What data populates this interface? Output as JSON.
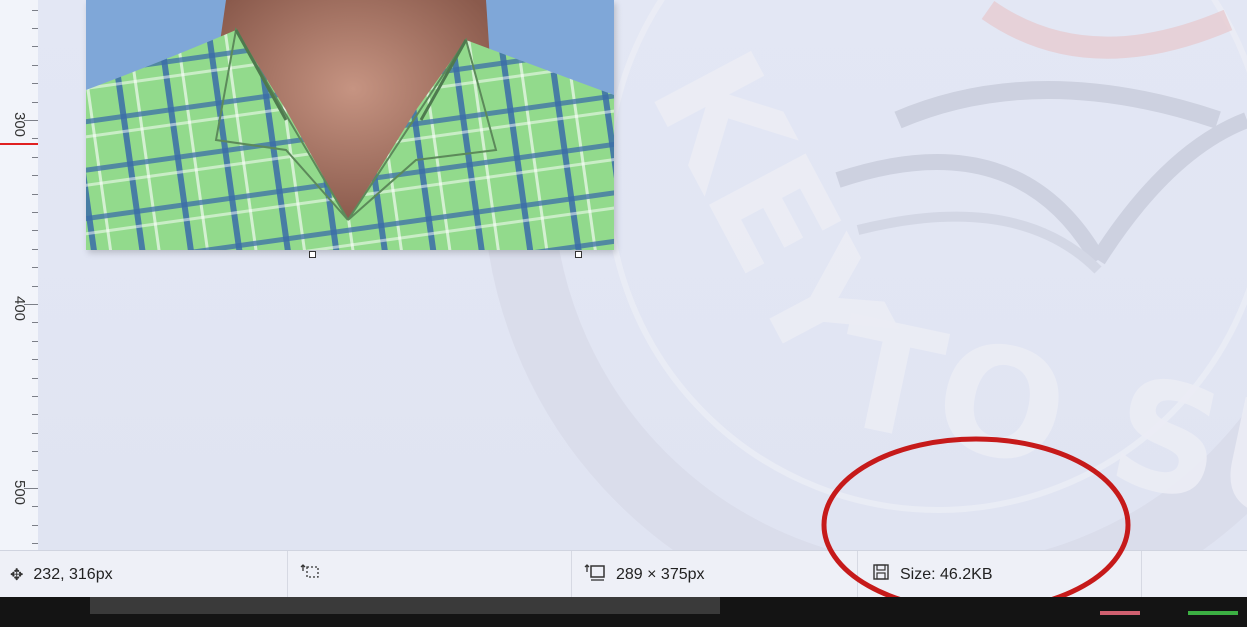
{
  "ruler": {
    "labels": [
      "300",
      "400",
      "500"
    ]
  },
  "statusbar": {
    "cursor_position": "232, 316px",
    "selection_size": "",
    "image_size": "289 × 375px",
    "file_size": "Size: 46.2KB",
    "icons": {
      "cursor": "move-crosshair-icon",
      "selection": "selection-icon",
      "image": "image-size-icon",
      "file": "save-disk-icon"
    }
  },
  "watermark": {
    "text": "KEY TO SUC"
  },
  "colors": {
    "annotation_ellipse": "#c61a1a",
    "ruler_cursor": "#e02020",
    "shirt_green": "#8fd68a",
    "shirt_stripe": "#2f5f9a"
  }
}
